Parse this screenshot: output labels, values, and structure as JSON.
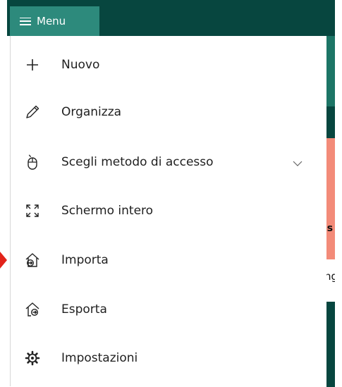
{
  "header": {
    "menu_label": "Menu"
  },
  "menu": {
    "items": [
      {
        "id": "nuovo",
        "label": "Nuovo",
        "icon": "plus-icon"
      },
      {
        "id": "organizza",
        "label": "Organizza",
        "icon": "pencil-icon"
      },
      {
        "id": "accesso",
        "label": "Scegli metodo di accesso",
        "icon": "mouse-icon",
        "has_submenu": true
      },
      {
        "id": "schermo",
        "label": "Schermo intero",
        "icon": "fullscreen-icon"
      },
      {
        "id": "importa",
        "label": "Importa",
        "icon": "import-icon"
      },
      {
        "id": "esporta",
        "label": "Esporta",
        "icon": "export-icon"
      },
      {
        "id": "impostazioni",
        "label": "Impostazioni",
        "icon": "gear-icon"
      }
    ]
  },
  "background": {
    "fragment1": "-s",
    "fragment2": "ng"
  },
  "colors": {
    "topbar": "#07463f",
    "menu_button": "#2d8a7c",
    "strip_teal": "#1d7566",
    "strip_salmon": "#f38b79",
    "pointer": "#e2231a"
  }
}
